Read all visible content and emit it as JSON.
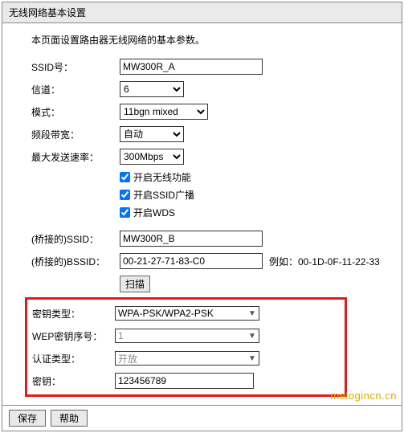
{
  "panel_title": "无线网络基本设置",
  "description": "本页面设置路由器无线网络的基本参数。",
  "labels": {
    "ssid": "SSID号：",
    "channel": "信道：",
    "mode": "模式：",
    "bandwidth": "频段带宽：",
    "max_rate": "最大发送速率：",
    "enable_wireless": "开启无线功能",
    "enable_ssid_broadcast": "开启SSID广播",
    "enable_wds": "开启WDS",
    "bridge_ssid": "(桥接的)SSID：",
    "bridge_bssid": "(桥接的)BSSID：",
    "bssid_example": "例如：00-1D-0F-11-22-33",
    "scan": "扫描",
    "key_type": "密钥类型：",
    "wep_index": "WEP密钥序号：",
    "auth_type": "认证类型：",
    "key": "密钥："
  },
  "values": {
    "ssid": "MW300R_A",
    "channel": "6",
    "mode": "11bgn mixed",
    "bandwidth": "自动",
    "max_rate": "300Mbps",
    "bridge_ssid": "MW300R_B",
    "bridge_bssid": "00-21-27-71-83-C0",
    "key_type": "WPA-PSK/WPA2-PSK",
    "wep_index": "1",
    "auth_type": "开放",
    "key": "123456789"
  },
  "checks": {
    "enable_wireless": true,
    "enable_ssid_broadcast": true,
    "enable_wds": true
  },
  "footer": {
    "save": "保存",
    "help": "帮助"
  },
  "watermark": "melogincn.cn"
}
